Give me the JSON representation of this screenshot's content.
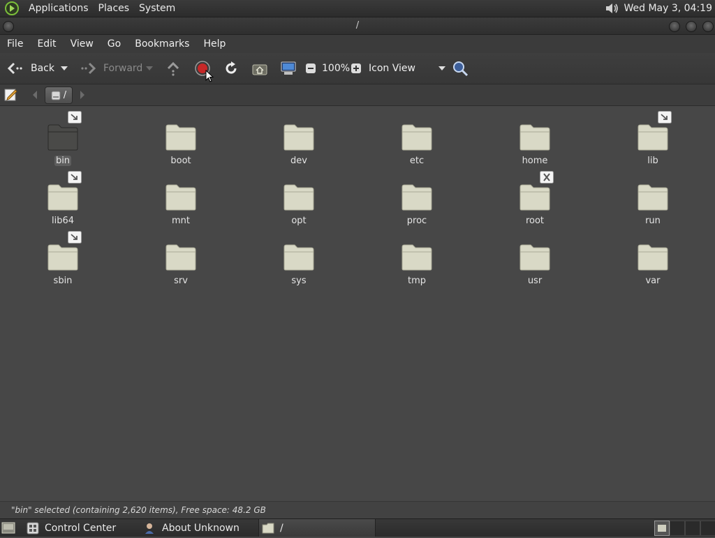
{
  "top_panel": {
    "menus": [
      "Applications",
      "Places",
      "System"
    ],
    "clock": "Wed May  3, 04:19",
    "icons": {
      "logo": "distro-logo-icon",
      "volume": "volume-icon"
    }
  },
  "window": {
    "title": "/"
  },
  "menubar": [
    "File",
    "Edit",
    "View",
    "Go",
    "Bookmarks",
    "Help"
  ],
  "toolbar": {
    "back_label": "Back",
    "forward_label": "Forward",
    "zoom_level": "100%",
    "view_mode": "Icon View"
  },
  "location": {
    "path_label": "/"
  },
  "files": [
    {
      "name": "bin",
      "emblem": "symlink",
      "selected": true
    },
    {
      "name": "boot",
      "emblem": "",
      "selected": false
    },
    {
      "name": "dev",
      "emblem": "",
      "selected": false
    },
    {
      "name": "etc",
      "emblem": "",
      "selected": false
    },
    {
      "name": "home",
      "emblem": "",
      "selected": false
    },
    {
      "name": "lib",
      "emblem": "symlink",
      "selected": false
    },
    {
      "name": "lib64",
      "emblem": "symlink",
      "selected": false
    },
    {
      "name": "mnt",
      "emblem": "",
      "selected": false
    },
    {
      "name": "opt",
      "emblem": "",
      "selected": false
    },
    {
      "name": "proc",
      "emblem": "",
      "selected": false
    },
    {
      "name": "root",
      "emblem": "unreadable",
      "selected": false
    },
    {
      "name": "run",
      "emblem": "",
      "selected": false
    },
    {
      "name": "sbin",
      "emblem": "symlink",
      "selected": false
    },
    {
      "name": "srv",
      "emblem": "",
      "selected": false
    },
    {
      "name": "sys",
      "emblem": "",
      "selected": false
    },
    {
      "name": "tmp",
      "emblem": "",
      "selected": false
    },
    {
      "name": "usr",
      "emblem": "",
      "selected": false
    },
    {
      "name": "var",
      "emblem": "",
      "selected": false
    }
  ],
  "status": {
    "text": "\"bin\" selected (containing 2,620 items), Free space: 48.2 GB"
  },
  "taskbar": {
    "items": [
      {
        "label": "Control Center",
        "icon": "control-center-icon"
      },
      {
        "label": "About Unknown",
        "icon": "about-me-icon"
      },
      {
        "label": "/",
        "icon": "folder-icon"
      }
    ]
  },
  "colors": {
    "background": "#474747",
    "folder_fill": "#d9d9c6",
    "folder_selected": "#4a4a48",
    "stop_red": "#c62828"
  }
}
